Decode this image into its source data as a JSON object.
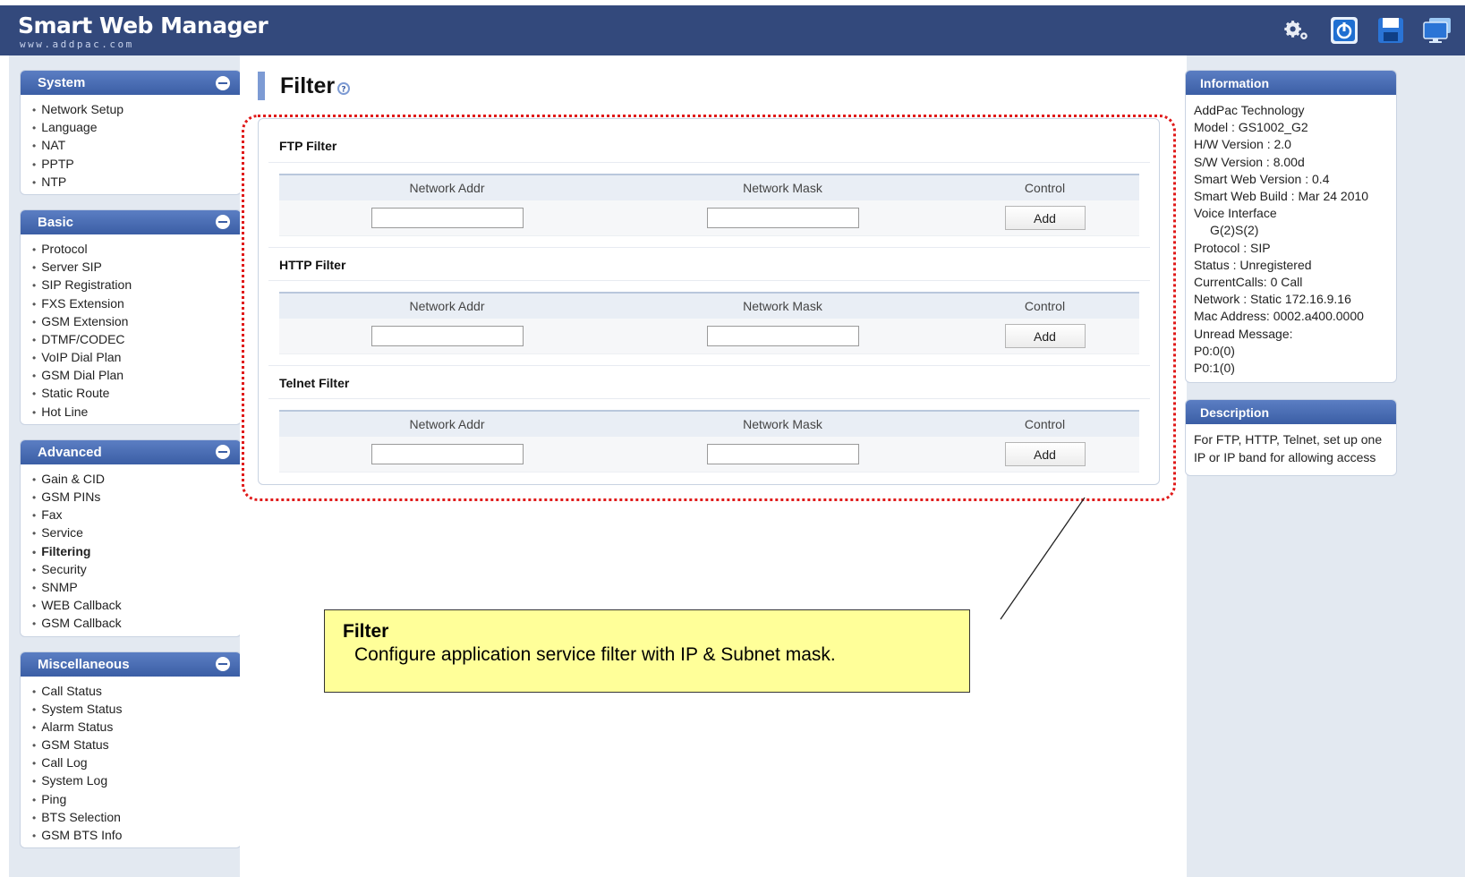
{
  "header": {
    "title": "Smart Web Manager",
    "subtitle": "www.addpac.com",
    "icons": [
      "settings-gear-icon",
      "power-icon",
      "save-disk-icon",
      "monitor-icon"
    ]
  },
  "sidebar": {
    "sections": [
      {
        "title": "System",
        "items": [
          "Network Setup",
          "Language",
          "NAT",
          "PPTP",
          "NTP"
        ]
      },
      {
        "title": "Basic",
        "items": [
          "Protocol",
          "Server SIP",
          "SIP Registration",
          "FXS Extension",
          "GSM Extension",
          "DTMF/CODEC",
          "VoIP Dial Plan",
          "GSM Dial Plan",
          "Static Route",
          "Hot Line"
        ]
      },
      {
        "title": "Advanced",
        "items": [
          "Gain & CID",
          "GSM PINs",
          "Fax",
          "Service",
          "Filtering",
          "Security",
          "SNMP",
          "WEB Callback",
          "GSM Callback"
        ]
      },
      {
        "title": "Miscellaneous",
        "items": [
          "Call Status",
          "System Status",
          "Alarm Status",
          "GSM Status",
          "Call Log",
          "System Log",
          "Ping",
          "BTS Selection",
          "GSM BTS Info"
        ]
      }
    ],
    "active_item": "Filtering"
  },
  "main": {
    "title": "Filter",
    "filters": [
      {
        "title": "FTP Filter",
        "col_addr": "Network Addr",
        "col_mask": "Network Mask",
        "col_control": "Control",
        "addr_value": "",
        "mask_value": "",
        "button": "Add"
      },
      {
        "title": "HTTP Filter",
        "col_addr": "Network Addr",
        "col_mask": "Network Mask",
        "col_control": "Control",
        "addr_value": "",
        "mask_value": "",
        "button": "Add"
      },
      {
        "title": "Telnet Filter",
        "col_addr": "Network Addr",
        "col_mask": "Network Mask",
        "col_control": "Control",
        "addr_value": "",
        "mask_value": "",
        "button": "Add"
      }
    ]
  },
  "callout": {
    "title": "Filter",
    "text": "Configure application service filter  with IP & Subnet mask."
  },
  "information": {
    "title": "Information",
    "lines": [
      "AddPac Technology",
      "Model : GS1002_G2",
      "H/W Version : 2.0",
      "S/W Version : 8.00d",
      "Smart Web Version : 0.4",
      "Smart Web Build : Mar 24 2010",
      "Voice Interface",
      "G(2)S(2)",
      "Protocol : SIP",
      "Status : Unregistered",
      "CurrentCalls: 0 Call",
      "Network : Static 172.16.9.16",
      "Mac Address: 0002.a400.0000",
      "Unread Message:",
      "P0:0(0)",
      "P0:1(0)"
    ]
  },
  "description": {
    "title": "Description",
    "text": "For FTP, HTTP, Telnet, set up one IP or IP band for allowing access"
  },
  "colors": {
    "header_bg": "#33497c",
    "panel_head": "#3b5ea5",
    "highlight": "#e01a1a",
    "callout_bg": "#ffff99"
  }
}
